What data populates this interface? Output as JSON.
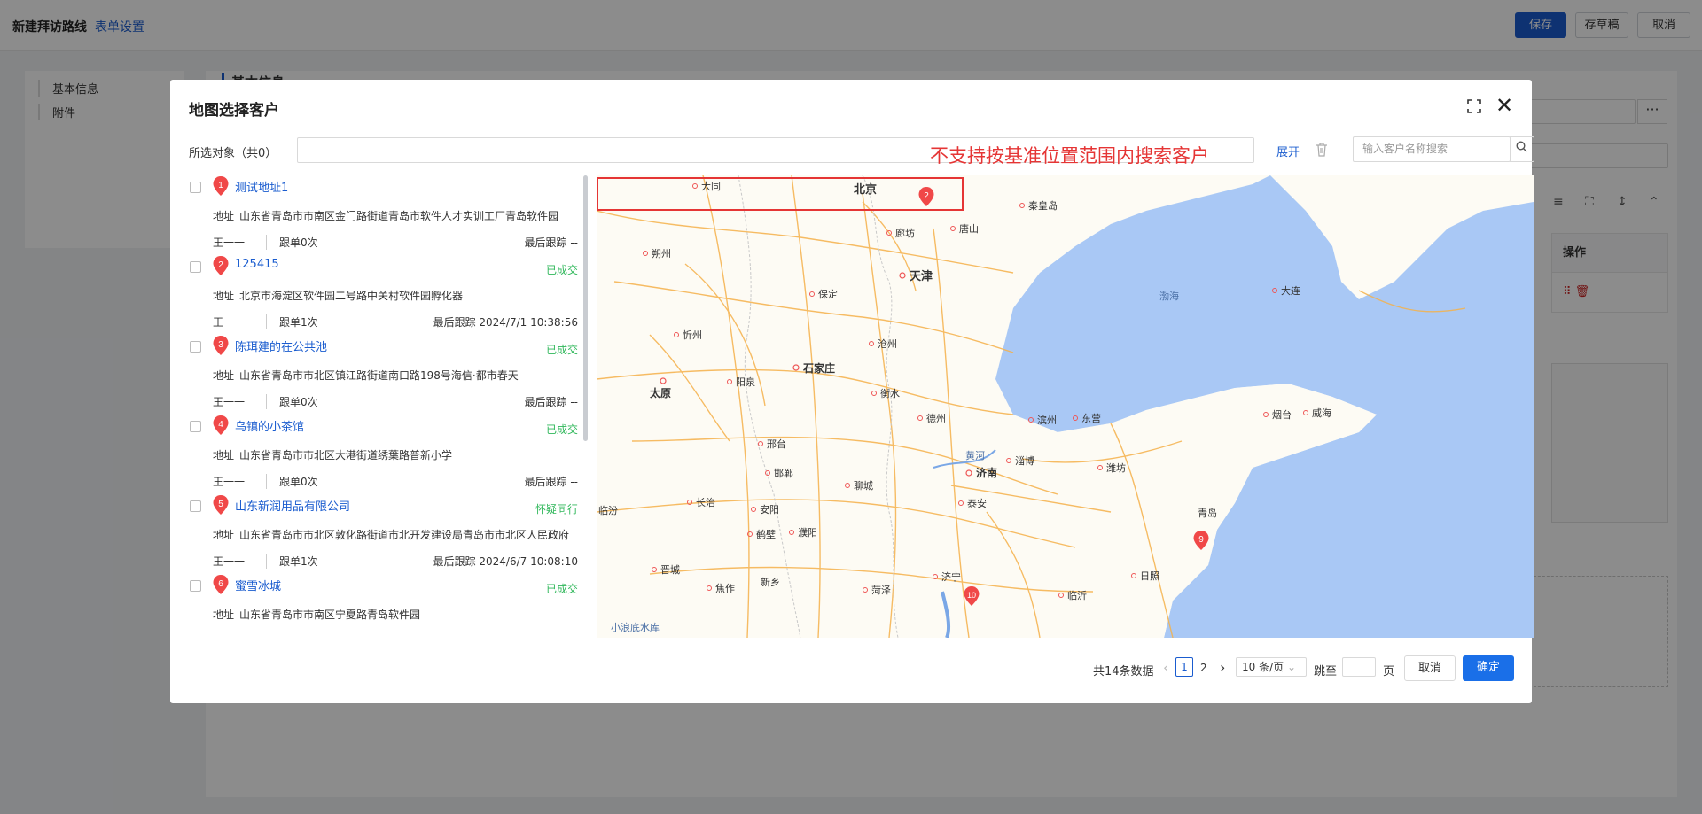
{
  "page": {
    "title": "新建拜访路线",
    "form_settings": "表单设置",
    "save": "保存",
    "draft": "存草稿",
    "cancel": "取消",
    "nav": [
      "基本信息",
      "附件"
    ],
    "section_title": "基本信息",
    "operation_header": "操作",
    "more": "···"
  },
  "modal": {
    "title": "地图选择客户",
    "selected_label": "所选对象（共0）",
    "expand": "展开",
    "search_placeholder": "输入客户名称搜索",
    "annotation": "不支持按基准位置范围内搜索客户",
    "customers": [
      {
        "num": "1",
        "name": "测试地址1",
        "status": "",
        "addr_label": "地址",
        "address": "山东省青岛市市南区金门路街道青岛市软件人才实训工厂青岛软件园",
        "owner": "王一一",
        "follow": "跟单0次",
        "last": "最后跟踪  --"
      },
      {
        "num": "2",
        "name": "125415",
        "status": "已成交",
        "addr_label": "地址",
        "address": "北京市海淀区软件园二号路中关村软件园孵化器",
        "owner": "王一一",
        "follow": "跟单1次",
        "last": "最后跟踪  2024/7/1 10:38:56"
      },
      {
        "num": "3",
        "name": "陈珥建的在公共池",
        "status": "已成交",
        "addr_label": "地址",
        "address": "山东省青岛市市北区镇江路街道南口路198号海信·都市春天",
        "owner": "王一一",
        "follow": "跟单0次",
        "last": "最后跟踪  --"
      },
      {
        "num": "4",
        "name": "乌镇的小茶馆",
        "status": "已成交",
        "addr_label": "地址",
        "address": "山东省青岛市市北区大港街道绣葉路普新小学",
        "owner": "王一一",
        "follow": "跟单0次",
        "last": "最后跟踪  --"
      },
      {
        "num": "5",
        "name": "山东新润用品有限公司",
        "status": "怀疑同行",
        "addr_label": "地址",
        "address": "山东省青岛市市北区敦化路街道市北开发建设局青岛市市北区人民政府",
        "owner": "王一一",
        "follow": "跟单1次",
        "last": "最后跟踪  2024/6/7 10:08:10"
      },
      {
        "num": "6",
        "name": "蜜雪冰城",
        "status": "已成交",
        "addr_label": "地址",
        "address": "山东省青岛市市南区宁夏路青岛软件园",
        "owner": "",
        "follow": "",
        "last": ""
      }
    ],
    "map_labels": {
      "datong": "大同",
      "beijing": "北京",
      "qinhuangdao": "秦皇岛",
      "shuozhou": "朔州",
      "langfang": "廊坊",
      "tangshan": "唐山",
      "baoding": "保定",
      "tianjin": "天津",
      "bohai": "渤海",
      "dalian": "大连",
      "xinzhou": "忻州",
      "cangzhou": "沧州",
      "shijiazhuang": "石家庄",
      "taiyuan": "太原",
      "yangquan": "阳泉",
      "hengshui": "衡水",
      "dezhou": "德州",
      "binzhou": "滨州",
      "dongying": "东营",
      "yantai": "烟台",
      "weihai": "威海",
      "xingtai": "邢台",
      "huanghe": "黄河",
      "zibo": "淄博",
      "jinan": "济南",
      "weifang": "潍坊",
      "handan": "邯郸",
      "liaocheng": "聊城",
      "linfen": "临汾",
      "changzhi": "长治",
      "anyang": "安阳",
      "taian": "泰安",
      "qingdao": "青岛",
      "hebi": "鹤壁",
      "puyang": "濮阳",
      "jincheng": "晋城",
      "jining": "济宁",
      "rizhao": "日照",
      "jiaozuo": "焦作",
      "xinxiang": "新乡",
      "heze": "菏泽",
      "linyi": "临沂",
      "xiaolangdi": "小浪底水库"
    },
    "map_pins": [
      "2",
      "9",
      "10"
    ],
    "pagination": {
      "total": "共14条数据",
      "prev": "‹",
      "page1": "1",
      "page2": "2",
      "next": "›",
      "page_size": "10 条/页",
      "jump": "跳至",
      "page_unit": "页",
      "cancel": "取消",
      "confirm": "确定"
    }
  },
  "colors": {
    "primary": "#1a5ccf",
    "success": "#2fb75a",
    "pin": "#f04848",
    "annotation": "#e53535",
    "sea": "#a9c8f5",
    "road": "#f5b14a"
  }
}
